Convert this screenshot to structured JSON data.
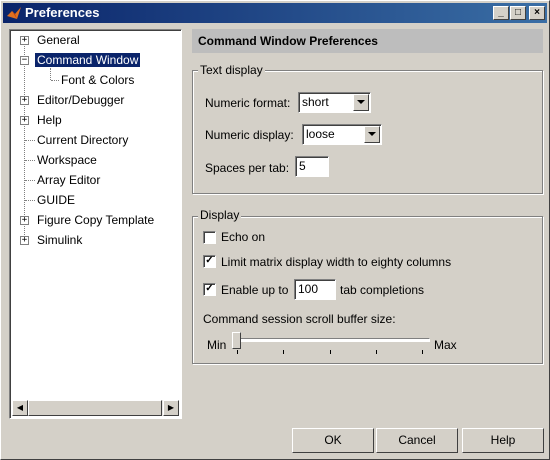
{
  "window": {
    "title": "Preferences",
    "controls": {
      "minimize": "_",
      "maximize": "□",
      "close": "×"
    }
  },
  "tree": {
    "items": [
      {
        "label": "General",
        "expander": "+"
      },
      {
        "label": "Command Window",
        "expander": "−"
      },
      {
        "label": "Font & Colors"
      },
      {
        "label": "Editor/Debugger",
        "expander": "+"
      },
      {
        "label": "Help",
        "expander": "+"
      },
      {
        "label": "Current Directory"
      },
      {
        "label": "Workspace"
      },
      {
        "label": "Array Editor"
      },
      {
        "label": "GUIDE"
      },
      {
        "label": "Figure Copy Template",
        "expander": "+"
      },
      {
        "label": "Simulink",
        "expander": "+"
      }
    ],
    "scroll_left": "◀",
    "scroll_right": "▶"
  },
  "panel": {
    "header": "Command Window Preferences",
    "text_display": {
      "title": "Text display",
      "numeric_format_label": "Numeric format:",
      "numeric_format_value": "short",
      "numeric_display_label": "Numeric display:",
      "numeric_display_value": "loose",
      "spaces_label": "Spaces per tab:",
      "spaces_value": "5"
    },
    "display": {
      "title": "Display",
      "echo_label": "Echo on",
      "echo_checked": false,
      "limit_label": "Limit matrix display width to eighty columns",
      "limit_checked": true,
      "enable_prefix": "Enable up to",
      "enable_value": "100",
      "enable_suffix": "tab completions",
      "enable_checked": true,
      "scroll_label": "Command session scroll buffer size:",
      "slider_min": "Min",
      "slider_max": "Max",
      "slider_level": 0
    }
  },
  "buttons": {
    "ok": "OK",
    "cancel": "Cancel",
    "help": "Help"
  },
  "glyphs": {
    "check": "✓"
  },
  "colors": {
    "title_bar": "#0a246a",
    "selection": "#0a246a",
    "header_bar": "#bdbdbd",
    "face": "#d4d0c8"
  }
}
